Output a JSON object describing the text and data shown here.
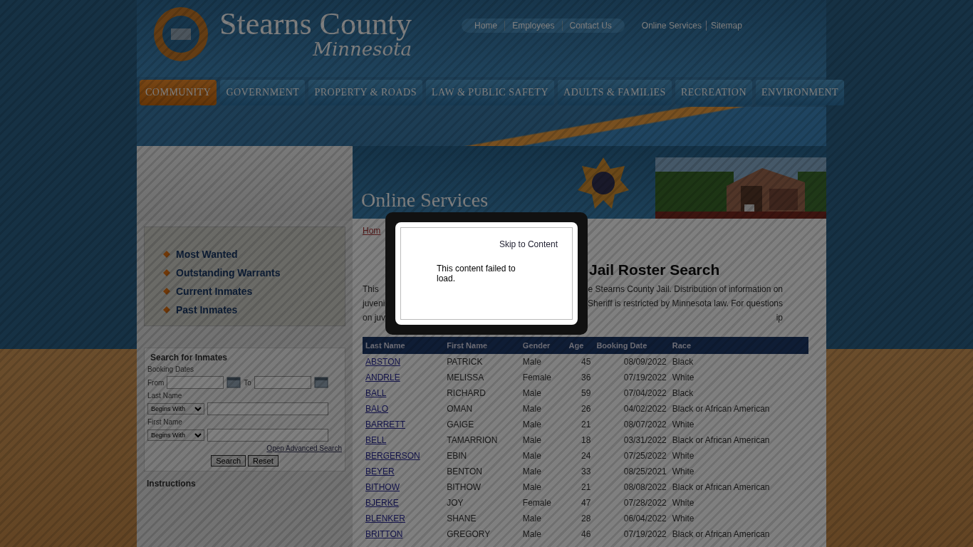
{
  "header": {
    "logo_title": "Stearns County",
    "logo_subtitle": "Minnesota",
    "top_links": [
      "Home",
      "Employees",
      "Contact Us"
    ],
    "utility_links": [
      "Online Services",
      "Sitemap"
    ]
  },
  "nav": [
    {
      "label": "COMMUNITY",
      "selected": true
    },
    {
      "label": "GOVERNMENT",
      "selected": false
    },
    {
      "label": "PROPERTY & ROADS",
      "selected": false
    },
    {
      "label": "LAW & PUBLIC SAFETY",
      "selected": false
    },
    {
      "label": "ADULTS & FAMILIES",
      "selected": false
    },
    {
      "label": "RECREATION",
      "selected": false
    },
    {
      "label": "ENVIRONMENT",
      "selected": false
    }
  ],
  "banner": {
    "title": "Online Services"
  },
  "sidebar": {
    "links": [
      "Most Wanted",
      "Outstanding Warrants",
      "Current Inmates",
      "Past Inmates"
    ],
    "search": {
      "title": "Search for Inmates",
      "booking_dates": "Booking Dates",
      "from": "From",
      "to": "To",
      "last_name": "Last Name",
      "first_name": "First Name",
      "last_name_match": "Begins With",
      "first_name_match": "Begins With",
      "advanced_link": "Open Advanced Search",
      "buttons": [
        "Search",
        "Reset"
      ]
    },
    "instructions_title": "Instructions"
  },
  "content": {
    "breadcrumb": "Hom",
    "heading": "Jail Roster Search",
    "intro_lines": [
      {
        "left": "This",
        "right": "e Stearns County Jail. Distribution of information on"
      },
      {
        "left": "juveni",
        "right": "Sheriff is restricted by Minnesota law. For questions"
      },
      {
        "left": "on juv",
        "right": "ip"
      }
    ],
    "table": {
      "columns": [
        "Last Name",
        "First Name",
        "Gender",
        "Age",
        "Booking Date",
        "Race"
      ],
      "rows": [
        [
          "ABSTON",
          "PATRICK",
          "Male",
          "45",
          "08/09/2022",
          "Black"
        ],
        [
          "ANDRLE",
          "MELISSA",
          "Female",
          "36",
          "07/19/2022",
          "White"
        ],
        [
          "BALL",
          "RICHARD",
          "Male",
          "59",
          "07/04/2022",
          "Black"
        ],
        [
          "BALO",
          "OMAN",
          "Male",
          "26",
          "04/02/2022",
          "Black or African American"
        ],
        [
          "BARRETT",
          "GAIGE",
          "Male",
          "21",
          "08/07/2022",
          "White"
        ],
        [
          "BELL",
          "TAMARRION",
          "Male",
          "18",
          "03/31/2022",
          "Black or African American"
        ],
        [
          "BERGERSON",
          "EBIN",
          "Male",
          "24",
          "07/25/2022",
          "White"
        ],
        [
          "BEYER",
          "BENTON",
          "Male",
          "33",
          "08/25/2021",
          "White"
        ],
        [
          "BITHOW",
          "BITHOW",
          "Male",
          "21",
          "08/08/2022",
          "Black or African American"
        ],
        [
          "BJERKE",
          "JOY",
          "Female",
          "47",
          "07/28/2022",
          "White"
        ],
        [
          "BLENKER",
          "SHANE",
          "Male",
          "28",
          "06/04/2022",
          "White"
        ],
        [
          "BRITTON",
          "GREGORY",
          "Male",
          "46",
          "07/19/2022",
          "Black or African American"
        ]
      ]
    }
  },
  "modal": {
    "skip_link": "Skip to Content",
    "message": "This content failed to load."
  }
}
